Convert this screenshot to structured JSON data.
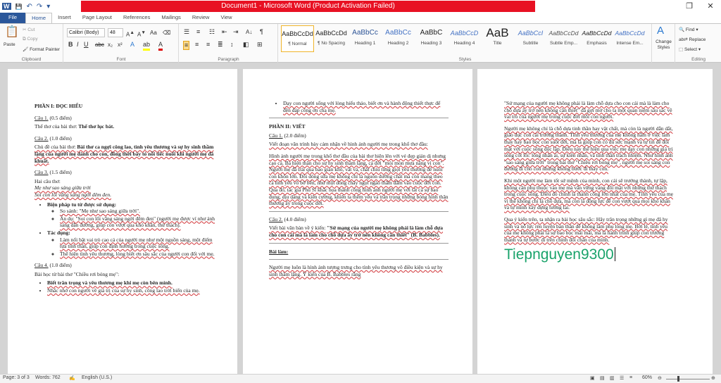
{
  "window": {
    "title": "Document1 - Microsoft Word (Product Activation Failed)",
    "controls": {
      "restore": "❐",
      "close": "✕"
    }
  },
  "qat": {
    "word_icon": "W",
    "save_icon": "💾",
    "undo_icon": "↶",
    "redo_icon": "↷",
    "more_icon": "▾"
  },
  "tabs": [
    "File",
    "Home",
    "Insert",
    "Page Layout",
    "References",
    "Mailings",
    "Review",
    "View"
  ],
  "ribbon": {
    "clipboard": {
      "paste": "Paste",
      "cut": "Cut",
      "copy": "Copy",
      "format_painter": "Format Painter",
      "label": "Clipboard"
    },
    "font": {
      "name": "Calibri (Body)",
      "size": "48",
      "label": "Font"
    },
    "paragraph": {
      "label": "Paragraph"
    },
    "styles": {
      "label": "Styles",
      "items": [
        {
          "preview": "AaBbCcDd",
          "name": "¶ Normal"
        },
        {
          "preview": "AaBbCcDd",
          "name": "¶ No Spacing"
        },
        {
          "preview": "AaBbCc",
          "name": "Heading 1"
        },
        {
          "preview": "AaBbCc",
          "name": "Heading 2"
        },
        {
          "preview": "AaBbC",
          "name": "Heading 3"
        },
        {
          "preview": "AaBbCcD",
          "name": "Heading 4"
        },
        {
          "preview": "AaB",
          "name": "Title"
        },
        {
          "preview": "AaBbCcI",
          "name": "Subtitle"
        },
        {
          "preview": "AaBbCcDd",
          "name": "Subtle Emp..."
        },
        {
          "preview": "AaBbCcDd",
          "name": "Emphasis"
        },
        {
          "preview": "AaBbCcDd",
          "name": "Intense Em..."
        }
      ],
      "change_styles": "Change Styles"
    },
    "editing": {
      "find": "Find",
      "replace": "Replace",
      "select": "Select",
      "label": "Editing"
    }
  },
  "page1": {
    "h1": "PHẦN I: ĐỌC HIỂU",
    "q1_label": "Câu 1.",
    "q1_points": "(0.5 điểm)",
    "q1_prompt": "Thể thơ của bài thơ:",
    "q1_answer": "Thể thơ lục bát.",
    "q2_label": "Câu 2.",
    "q2_points": "(1.0 điểm)",
    "q2_prompt": "Chủ đề của bài thơ:",
    "q2_answer": "Bài thơ ca ngợi công lao, tình yêu thương và sự hy sinh thầm lặng của người mẹ dành cho con, đồng thời bày tỏ nỗi tiếc nuối khi người mẹ đã khuất.",
    "q3_label": "Câu 3.",
    "q3_points": "(1.5 điểm)",
    "q3_prompt": "Hai câu thơ:",
    "q3_line1": "Mẹ như sao sáng giữa trời",
    "q3_line2": "Soi con lối vắng sáng ngời đêm đen.",
    "q3_b1": "Biện pháp tu từ được sử dụng:",
    "q3_b1_s1": "So sánh: \"Mẹ như sao sáng giữa trời\".",
    "q3_b1_s2": "Ẩn dụ: \"Soi con lối vắng sáng ngời đêm đen\" (người mẹ được ví như ánh sáng dẫn đường, giúp con vượt qua khó khăn, thử thách).",
    "q3_b2": "Tác dụng:",
    "q3_b2_s1": "Làm nổi bật vai trò cao cả của người mẹ như một nguồn sáng, một điểm tựa tinh thần, giúp con định hướng trong cuộc sống.",
    "q3_b2_s2": "Thể hiện tình yêu thương, lòng biết ơn sâu sắc của người con đối với mẹ.",
    "q4_label": "Câu 4.",
    "q4_points": "(1.0 điểm)",
    "q4_prompt": "Bài học từ bài thơ \"Chiều rơi bóng mẹ\":",
    "q4_b1": "Biết trân trọng và yêu thương mẹ khi mẹ còn bên mình.",
    "q4_b2": "Nhắc nhở con người về giá trị của sự hy sinh, công lao trời biển của mẹ."
  },
  "page2": {
    "b_top": "Dạy con người sống với lòng hiếu thảo, biết ơn và hành động thiết thực để đền đáp công ơn cha mẹ.",
    "h2": "PHẦN II: VIẾT",
    "c1_label": "Câu 1.",
    "c1_points": "(2.0 điểm)",
    "c1_prompt": "Viết đoạn văn trình bày cảm nhận về hình ảnh người mẹ trong khổ thơ đầu:",
    "c1_answer": "Hình ảnh người mẹ trong khổ thơ đầu của bài thơ hiện lên với vẻ đẹp giản dị nhưng cao cả. Bà hiện thân cho sự hy sinh thầm lặng, cả đời \"mỏi mòn mưa nắng vì con\". Người mẹ đã trải qua bao gian khổ, vất vả, chắt chiu từng giọt yêu thương để nuôi con khôn lớn. Đôi dòng sữa mẹ không chỉ là nguồn dưỡng chất mà còn mang theo cả tình yêu vô bờ bến, như một dòng chảy ngọt ngào thấm đẫm vào cuộc đời con. Qua đó, tác giả Phù Sĩ khắc họa thành công hình ảnh người mẹ với tất cả sự bao dung, dịu dàng và kiên cường, khiến ta thêm yêu và trân trọng những bóng hình thân thương ấy trong cuộc đời.",
    "c2_label": "Câu 2.",
    "c2_points": "(4.0 điểm)",
    "c2_prompt": "Viết bài văn bàn về ý kiến:",
    "c2_quote": "\"Sứ mạng của người mẹ không phải là làm chỗ dựa cho con cái mà là làm cho chỗ dựa ấy trở nên không cần thiết\" (B. Babbles).",
    "bai_lam": "Bài làm:",
    "bl_p1": "Người mẹ luôn là hình ảnh tượng trưng cho tình yêu thương vô điều kiện và sự hy sinh thầm lặng. Ý kiến của B. Babbles rằng"
  },
  "page3": {
    "p1": "\"Sứ mạng của người mẹ không phải là làm chỗ dựa cho con cái mà là làm cho chỗ dựa ấy trở nên không cần thiết\" đã gợi mở cho ta một quan niệm sâu sắc về vai trò của người mẹ trong cuộc đời mỗi con người.",
    "p2": "Người mẹ không chỉ là chỗ dựa tinh thần hay vật chất, mà còn là người dẫn dắt, giáo dục con cái trưởng thành. Tình yêu thương của mẹ không nằm ở việc làm thay hay bao bọc con suốt đời, mà là giúp con có đủ sức mạnh và tự tin để đối mặt với cuộc sống độc lập. Điều này thể hiện qua việc mẹ dạy con những giá trị sống cốt lõi: lòng nhân ái, sự kiên nhẫn, và tinh thần trách nhiệm. Như hình ảnh \"sao sáng giữa trời\" trong bài thơ \"Chiều rơi bóng mẹ\", người mẹ soi sáng con đường đi cho con nhưng không bước đi thay con.",
    "p3": "Khi một người mẹ làm tốt sứ mệnh của mình, con cái sẽ trưởng thành, tự lập, không cần phụ thuộc vào mẹ mà vẫn vững vàng đối mặt với những thử thách trong cuộc sống. Điều đó chính là thành công lớn nhất của mẹ. Tình yêu của mẹ vì thế không chỉ là chỗ dựa, mà còn là động lực để con vượt qua mọi khó khăn và tự mình xây dựng tương lai.",
    "p4": "Qua ý kiến trên, ta nhận ra bài học sâu sắc: Hãy trân trọng những gì mẹ đã hy sinh và nỗ lực rèn luyện bản thân để không làm phụ lòng mẹ. Bởi lẽ, tình yêu của mẹ không phải là sự bao bọc mãi mãi, mà là hành trình giúp con trưởng thành và tự bước đi trên chính đôi chân của mình.",
    "big": "Tiepnguyen9300"
  },
  "status": {
    "page": "Page: 3 of 3",
    "words": "Words: 762",
    "lang": "English (U.S.)",
    "zoom": "60%",
    "zoom_value": 0.6
  }
}
